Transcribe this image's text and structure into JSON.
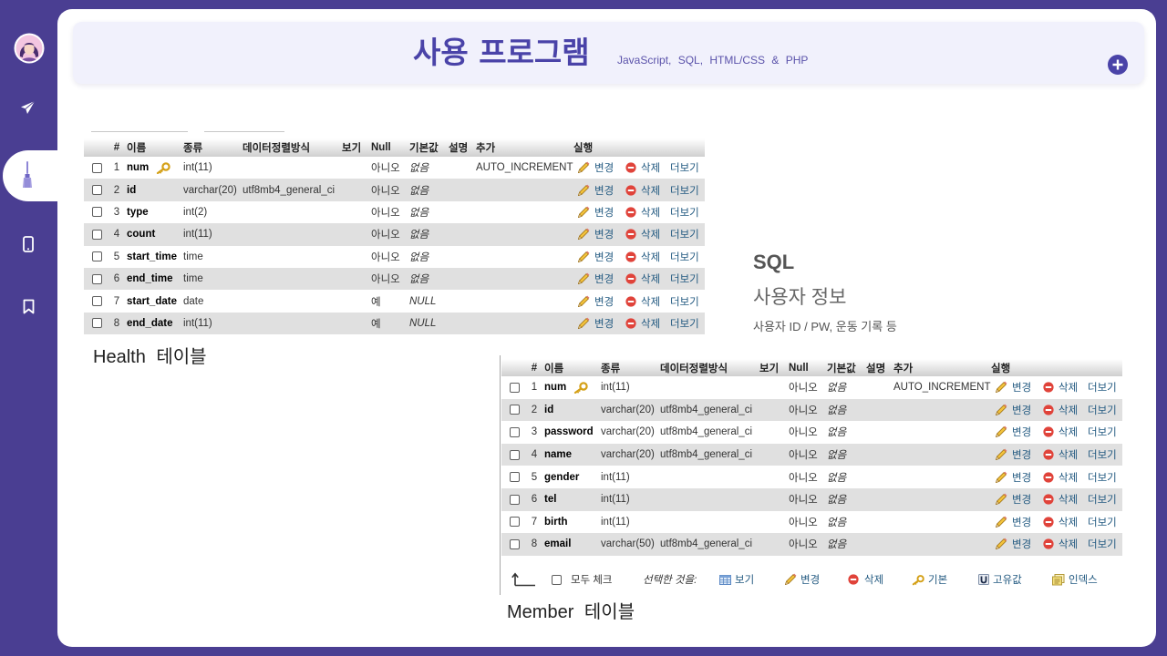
{
  "colors": {
    "page_background": "#4a3e92",
    "card_background": "#ffffff",
    "header_background": "#f1f1fc",
    "accent": "#4a43a8",
    "link": "#235a81",
    "row_alternate": "#e0e0e0",
    "delete": "#e0433a",
    "key": "#d4a017"
  },
  "sidebar": {
    "items": [
      {
        "icon": "avatar-icon"
      },
      {
        "icon": "paper-plane-icon"
      },
      {
        "icon": "brush-icon",
        "active": true
      },
      {
        "icon": "phone-icon"
      },
      {
        "icon": "bookmark-icon"
      }
    ]
  },
  "header": {
    "title": "사용 프로그램",
    "subtitle": "JavaScript, SQL, HTML/CSS & PHP",
    "add_icon": "plus-circle-icon"
  },
  "health_table": {
    "caption": "Health 테이블",
    "columns": [
      "#",
      "이름",
      "종류",
      "데이터정렬방식",
      "보기",
      "Null",
      "기본값",
      "설명",
      "추가",
      "실행"
    ],
    "actions": {
      "edit": "변경",
      "delete": "삭제",
      "more": "더보기"
    },
    "rows": [
      {
        "no": "1",
        "name": "num",
        "name_icon": "key-icon",
        "type": "int(11)",
        "null": "아니오",
        "default": "없음",
        "extra": "AUTO_INCREMENT"
      },
      {
        "no": "2",
        "name": "id",
        "type": "varchar(20)",
        "collation": "utf8mb4_general_ci",
        "null": "아니오",
        "default": "없음"
      },
      {
        "no": "3",
        "name": "type",
        "type": "int(2)",
        "null": "아니오",
        "default": "없음"
      },
      {
        "no": "4",
        "name": "count",
        "type": "int(11)",
        "null": "아니오",
        "default": "없음"
      },
      {
        "no": "5",
        "name": "start_time",
        "type": "time",
        "null": "아니오",
        "default": "없음"
      },
      {
        "no": "6",
        "name": "end_time",
        "type": "time",
        "null": "아니오",
        "default": "없음"
      },
      {
        "no": "7",
        "name": "start_date",
        "type": "date",
        "null": "예",
        "default": "NULL"
      },
      {
        "no": "8",
        "name": "end_date",
        "type": "int(11)",
        "null": "예",
        "default": "NULL"
      }
    ]
  },
  "info": {
    "heading": "SQL",
    "title": "사용자 정보",
    "description": "사용자 ID / PW, 운동 기록 등"
  },
  "member_table": {
    "caption": "Member 테이블",
    "columns": [
      "#",
      "이름",
      "종류",
      "데이터정렬방식",
      "보기",
      "Null",
      "기본값",
      "설명",
      "추가",
      "실행"
    ],
    "actions": {
      "edit": "변경",
      "delete": "삭제",
      "more": "더보기"
    },
    "rows": [
      {
        "no": "1",
        "name": "num",
        "name_icon": "key-icon",
        "type": "int(11)",
        "null": "아니오",
        "default": "없음",
        "extra": "AUTO_INCREMENT"
      },
      {
        "no": "2",
        "name": "id",
        "type": "varchar(20)",
        "collation": "utf8mb4_general_ci",
        "null": "아니오",
        "default": "없음"
      },
      {
        "no": "3",
        "name": "password",
        "type": "varchar(20)",
        "collation": "utf8mb4_general_ci",
        "null": "아니오",
        "default": "없음"
      },
      {
        "no": "4",
        "name": "name",
        "type": "varchar(20)",
        "collation": "utf8mb4_general_ci",
        "null": "아니오",
        "default": "없음"
      },
      {
        "no": "5",
        "name": "gender",
        "type": "int(11)",
        "null": "아니오",
        "default": "없음"
      },
      {
        "no": "6",
        "name": "tel",
        "type": "int(11)",
        "null": "아니오",
        "default": "없음"
      },
      {
        "no": "7",
        "name": "birth",
        "type": "int(11)",
        "null": "아니오",
        "default": "없음"
      },
      {
        "no": "8",
        "name": "email",
        "type": "varchar(50)",
        "collation": "utf8mb4_general_ci",
        "null": "아니오",
        "default": "없음"
      }
    ],
    "footer": {
      "check_all": "모두 체크",
      "with_selected": "선택한 것을:",
      "actions": [
        {
          "icon": "browse-icon",
          "label": "보기"
        },
        {
          "icon": "pencil-icon",
          "label": "변경"
        },
        {
          "icon": "delete-icon",
          "label": "삭제"
        },
        {
          "icon": "key-icon",
          "label": "기본"
        },
        {
          "icon": "unique-icon",
          "label": "고유값"
        },
        {
          "icon": "index-icon",
          "label": "인덱스"
        }
      ]
    }
  }
}
